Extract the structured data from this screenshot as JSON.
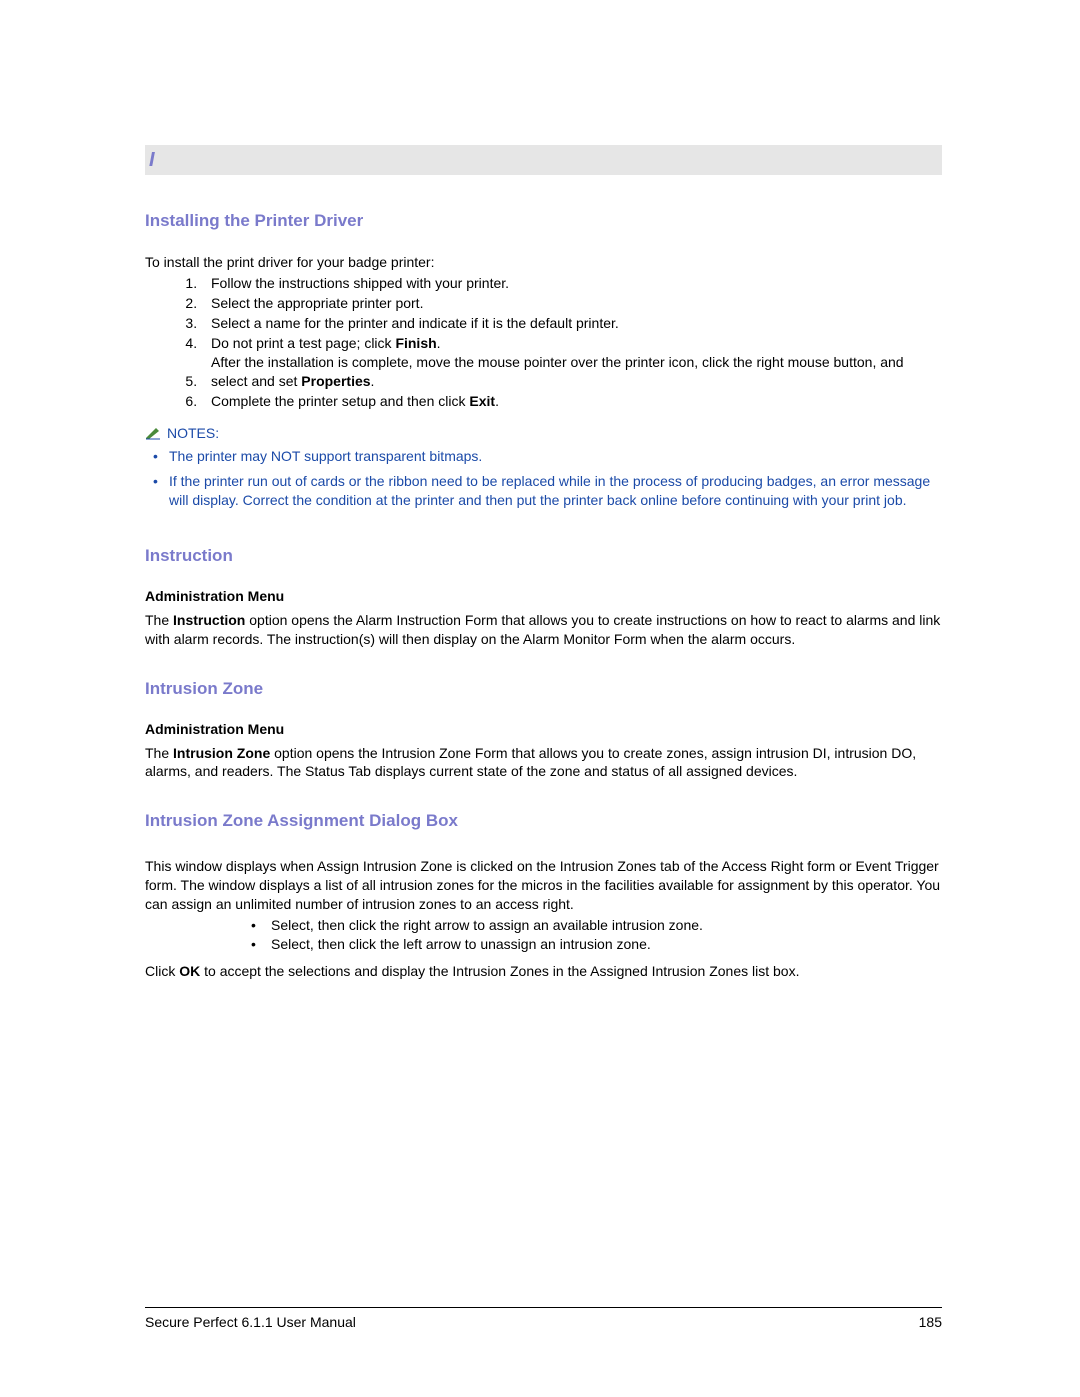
{
  "letter": "I",
  "sec1": {
    "title": "Installing the Printer Driver",
    "intro": "To install the print driver for your badge printer:",
    "step1": "Follow the instructions shipped with your printer.",
    "step2": "Select the appropriate printer port.",
    "step3": "Select a name for the printer and indicate if it is the default printer.",
    "step4_a": "Do not print a test page; click ",
    "step4_b": "Finish",
    "step4_c": ".",
    "step5_a": "After the installation is complete, move the mouse pointer over the printer icon, click the right mouse button, and select and set ",
    "step5_b": "Properties",
    "step5_c": ".",
    "step6_a": "Complete the printer setup and then click ",
    "step6_b": "Exit",
    "step6_c": ".",
    "notes_label": "NOTES:",
    "note1": "The printer may NOT support transparent bitmaps.",
    "note2": "If the printer run out of cards or the ribbon need to be replaced while in the process of producing badges, an error message will display. Correct the condition at the printer and then put the printer back online before continuing with your print job."
  },
  "sec2": {
    "title": "Instruction",
    "menu": "Administration Menu",
    "p_a": "The ",
    "p_b": "Instruction",
    "p_c": " option opens the Alarm Instruction Form that allows you to create instructions on how to react to alarms and link with alarm records. The instruction(s) will then display on the Alarm Monitor Form when the alarm occurs."
  },
  "sec3": {
    "title": "Intrusion Zone",
    "menu": "Administration Menu",
    "p_a": "The ",
    "p_b": "Intrusion Zone",
    "p_c": " option opens the Intrusion Zone Form that allows you to create zones, assign intrusion DI, intrusion DO, alarms, and readers. The Status Tab displays current state of the zone and status of all assigned devices."
  },
  "sec4": {
    "title": "Intrusion Zone Assignment Dialog Box",
    "p1": "This window displays when Assign Intrusion Zone is clicked on the Intrusion Zones tab of the Access Right form or Event Trigger form. The window displays a list of all intrusion zones for the micros in the facilities available for assignment by this operator. You can assign an unlimited number of intrusion zones to an access right.",
    "a1": "Select, then click the right arrow to assign an available intrusion zone.",
    "a2": "Select, then click the left arrow to unassign an intrusion zone.",
    "p2_a": "Click ",
    "p2_b": "OK",
    "p2_c": " to accept the selections and display the Intrusion Zones in the Assigned Intrusion Zones list box."
  },
  "footer": {
    "left": "Secure Perfect 6.1.1 User Manual",
    "right": "185"
  }
}
